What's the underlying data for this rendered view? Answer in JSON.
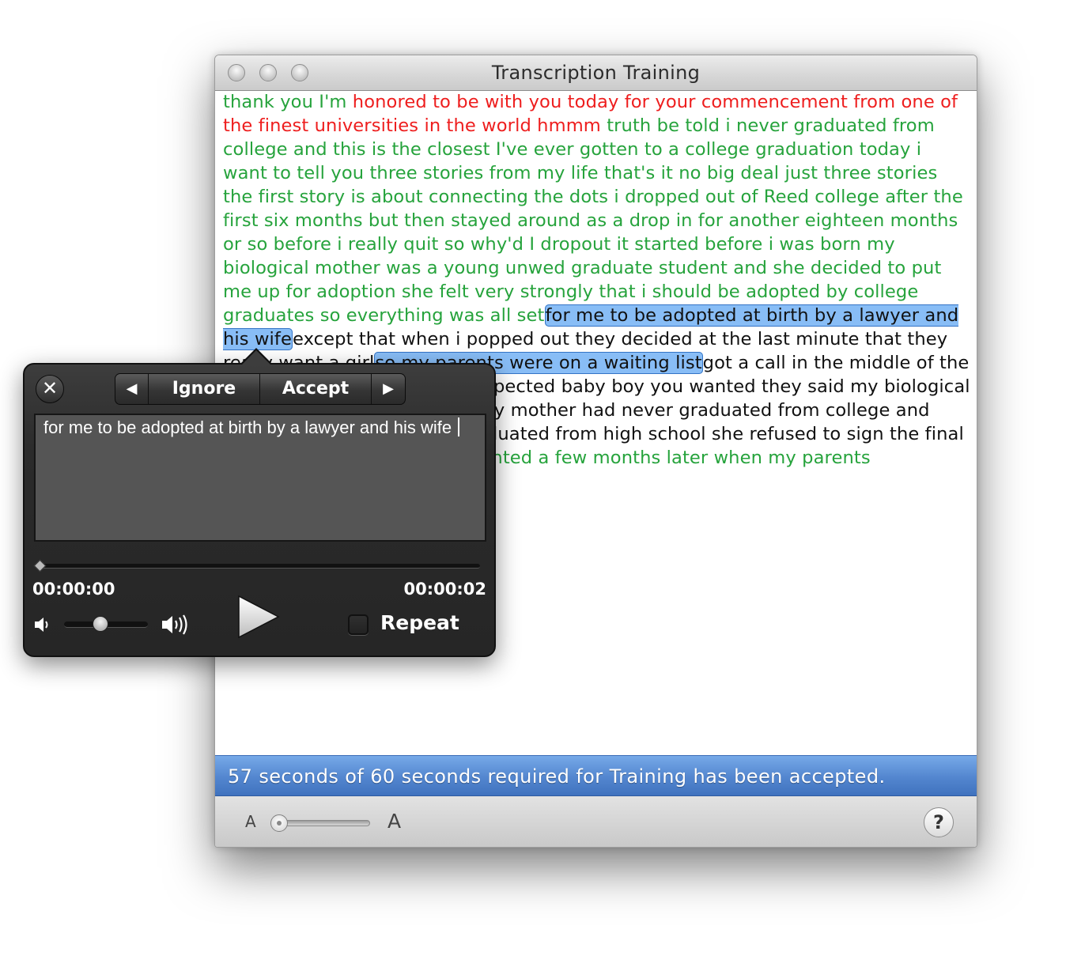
{
  "window": {
    "title": "Transcription Training"
  },
  "transcript": {
    "segments": [
      {
        "text": "thank you I'm ",
        "style": "g"
      },
      {
        "text": "honored to be with you today for your commencement from one of the finest universities in the world hmmm ",
        "style": "r"
      },
      {
        "text": "truth be told i never graduated from college and this is the closest I've ever gotten to a college graduation today i want to tell you three stories from my life that's it no big deal just three stories the first story is about connecting the dots i dropped out of Reed college after the first six months but then stayed around as a drop in for another eighteen months or so before i really quit so why'd I dropout it started before i was born my biological mother was a young unwed graduate student and she decided to put me up for adoption she felt very strongly that i should be adopted by college graduates so everything was all set",
        "style": "g"
      },
      {
        "text": "for me to be adopted at birth by a lawyer and his wife",
        "style": "hl"
      },
      {
        "text": "except that when i popped out they decided at the last minute that they really want a girl",
        "style": "k"
      },
      {
        "text": "so my parents were on a waiting list",
        "style": "hl"
      },
      {
        "text": "got a call in the middle of the night asking we have an unexpected baby boy you wanted they said my biological mother found out later that my mother had never graduated from college and that my father had never graduated from high school she refused to sign the final adoption papers she ",
        "style": "k"
      },
      {
        "text": "only relented a few months later when my parents",
        "style": "g"
      }
    ]
  },
  "status": {
    "message": "57 seconds of 60 seconds required for Training has been accepted."
  },
  "bottombar": {
    "font_small_label": "A",
    "font_large_label": "A",
    "help_label": "?"
  },
  "hud": {
    "close_label": "✕",
    "prev_label": "◀",
    "ignore_label": "Ignore",
    "accept_label": "Accept",
    "next_label": "▶",
    "edit_text": "for me to be adopted at birth by a lawyer and his wife ",
    "time_current": "00:00:00",
    "time_total": "00:00:02",
    "repeat_label": "Repeat",
    "repeat_checked": false,
    "volume_level": 0.42,
    "playback_progress": 0.0
  },
  "colors": {
    "accepted_text": "#26a33c",
    "rejected_text": "#ee1e1e",
    "highlight_fill": "#88bdf6",
    "highlight_border": "#3474c6",
    "status_bar": "#5386cf"
  }
}
